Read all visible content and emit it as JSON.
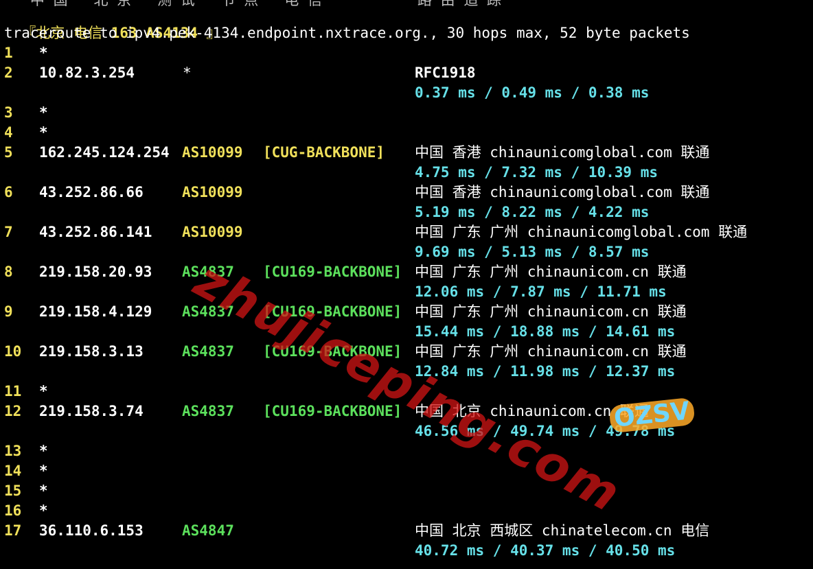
{
  "header_cut": "   中 国   北 京   测 试   节 点   电 信           路 由 追 踪",
  "target": {
    "open": "『北京 电信 ",
    "name": "163 AS4134",
    "close": " 』"
  },
  "command": "traceroute to ipv4.pek-4134.endpoint.nxtrace.org., 30 hops max, 52 byte packets",
  "colors": {
    "hop": "#f0e05a",
    "asn_yellow": "#f0e05a",
    "asn_green": "#5ce05c",
    "rtt": "#66e0e8"
  },
  "hops": [
    {
      "n": "1",
      "star": "*"
    },
    {
      "n": "2",
      "ip": "10.82.3.254",
      "star2": "*",
      "geo": "RFC1918",
      "rtt": "0.37 ms / 0.49 ms / 0.38 ms"
    },
    {
      "n": "3",
      "star": "*"
    },
    {
      "n": "4",
      "star": "*"
    },
    {
      "n": "5",
      "ip": "162.245.124.254",
      "asn": "AS10099",
      "tag": "[CUG-BACKBONE]",
      "geo": "中国 香港   chinaunicomglobal.com  联通",
      "rtt": "4.75 ms / 7.32 ms / 10.39 ms"
    },
    {
      "n": "6",
      "ip": "43.252.86.66",
      "asn": "AS10099",
      "geo": "中国 香港   chinaunicomglobal.com  联通",
      "rtt": "5.19 ms / 8.22 ms / 4.22 ms"
    },
    {
      "n": "7",
      "ip": "43.252.86.141",
      "asn": "AS10099",
      "geo": "中国 广东 广州  chinaunicomglobal.com  联通",
      "rtt": "9.69 ms / 5.13 ms / 8.57 ms"
    },
    {
      "n": "8",
      "ip": "219.158.20.93",
      "asn": "AS4837",
      "tag": "[CU169-BACKBONE]",
      "geo": "中国 广东 广州  chinaunicom.cn  联通",
      "rtt": "12.06 ms / 7.87 ms / 11.71 ms"
    },
    {
      "n": "9",
      "ip": "219.158.4.129",
      "asn": "AS4837",
      "tag": "[CU169-BACKBONE]",
      "geo": "中国 广东 广州  chinaunicom.cn  联通",
      "rtt": "15.44 ms / 18.88 ms / 14.61 ms"
    },
    {
      "n": "10",
      "ip": "219.158.3.13",
      "asn": "AS4837",
      "tag": "[CU169-BACKBONE]",
      "geo": "中国 广东 广州  chinaunicom.cn  联通",
      "rtt": "12.84 ms / 11.98 ms / 12.37 ms"
    },
    {
      "n": "11",
      "star": "*"
    },
    {
      "n": "12",
      "ip": "219.158.3.74",
      "asn": "AS4837",
      "tag": "[CU169-BACKBONE]",
      "geo": "中国 北京   chinaunicom.cn  联通",
      "rtt": "46.56 ms / 49.74 ms / 49.78 ms"
    },
    {
      "n": "13",
      "star": "*"
    },
    {
      "n": "14",
      "star": "*"
    },
    {
      "n": "15",
      "star": "*"
    },
    {
      "n": "16",
      "star": "*"
    },
    {
      "n": "17",
      "ip": "36.110.6.153",
      "asn": "AS4847",
      "geo": "中国 北京  西城区 chinatelecom.cn  电信",
      "rtt": "40.72 ms / 40.37 ms / 40.50 ms"
    }
  ],
  "watermarks": {
    "site": "zhujiceping.com",
    "badge": "OZSV"
  }
}
